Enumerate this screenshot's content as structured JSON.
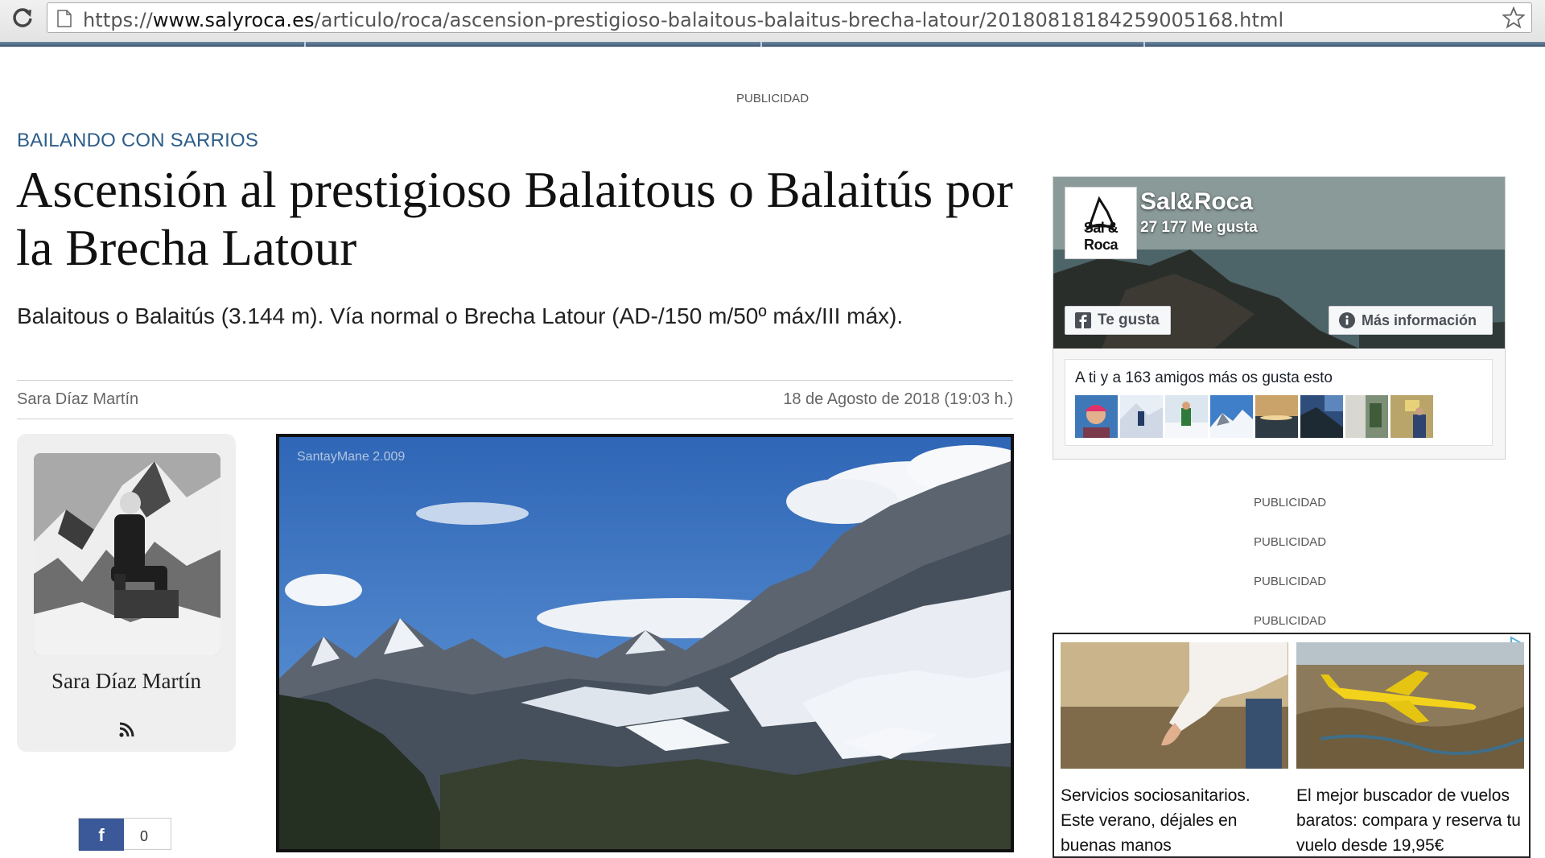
{
  "browser": {
    "url_prefix": "https://",
    "url_host": "www.salyroca.es",
    "url_path": "/articulo/roca/ascension-prestigioso-balaitous-balaitus-brecha-latour/20180818184259005168.html"
  },
  "ads": {
    "top_label": "PUBLICIDAD",
    "side_labels": [
      "PUBLICIDAD",
      "PUBLICIDAD",
      "PUBLICIDAD",
      "PUBLICIDAD"
    ]
  },
  "article": {
    "section": "BAILANDO CON SARRIOS",
    "title": "Ascensión al prestigioso Balaitous o Balaitús por la Brecha Latour",
    "subtitle": "Balaitous o Balaitús (3.144 m). Vía normal o Brecha Latour (AD-/150 m/50º máx/III máx).",
    "author": "Sara Díaz Martín",
    "date": "18 de Agosto de 2018 (19:03 h.)",
    "photo_credit": "SantayMane 2.009"
  },
  "author_card": {
    "name": "Sara Díaz Martín",
    "icon": "rss-icon"
  },
  "share": {
    "label": "f",
    "count": "0"
  },
  "facebook_widget": {
    "page_name": "Sal&Roca",
    "likes": "27 177 Me gusta",
    "logo_text": "Sal & Roca",
    "like_button": "Te gusta",
    "info_button": "Más información",
    "friends_text": "A ti y a 163 amigos más os gusta esto",
    "friend_count_shown": 8,
    "brand_color": "#3b5998"
  },
  "ad_block": {
    "cards": [
      {
        "text": "Servicios sociosanitarios. Este verano, déjales en buenas manos"
      },
      {
        "text": "El mejor buscador de vuelos baratos: compara y reserva tu vuelo desde 19,95€"
      }
    ]
  }
}
